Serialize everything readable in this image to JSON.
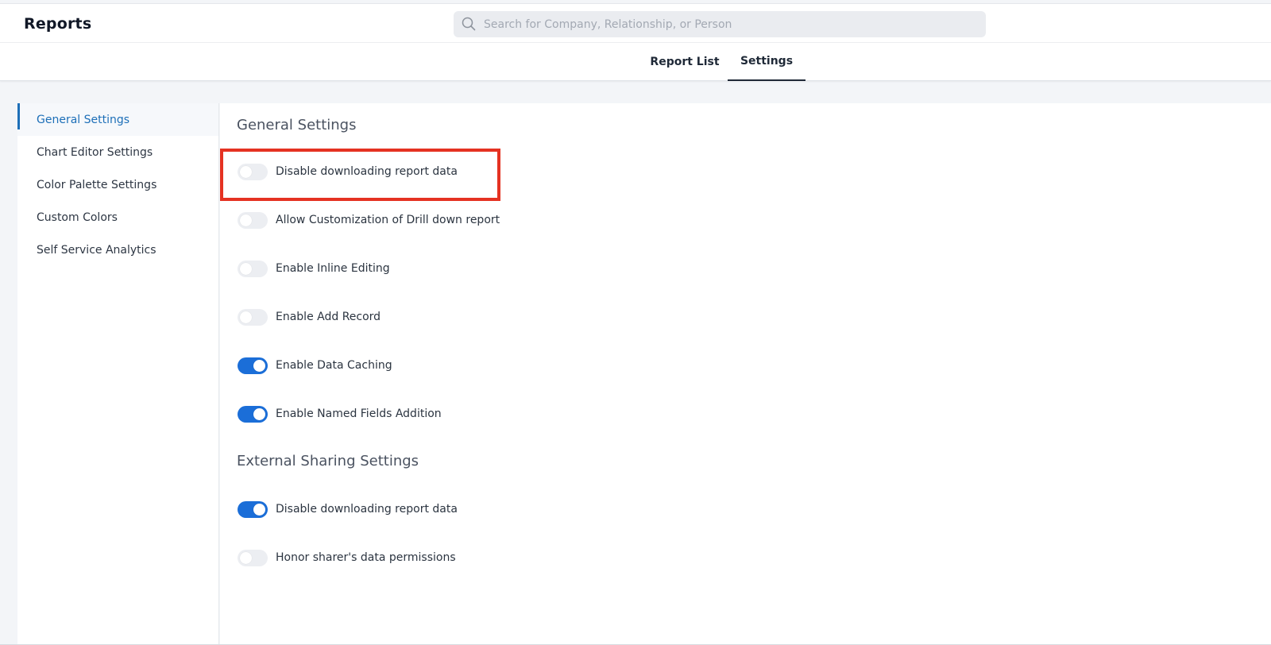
{
  "header": {
    "app_title": "Reports",
    "search_placeholder": "Search for Company, Relationship, or Person"
  },
  "tabs": [
    {
      "label": "Report List",
      "active": false
    },
    {
      "label": "Settings",
      "active": true
    }
  ],
  "sidebar": {
    "items": [
      {
        "label": "General Settings",
        "active": true
      },
      {
        "label": "Chart Editor Settings",
        "active": false
      },
      {
        "label": "Color Palette Settings",
        "active": false
      },
      {
        "label": "Custom Colors",
        "active": false
      },
      {
        "label": "Self Service Analytics",
        "active": false
      }
    ]
  },
  "general_settings": {
    "title": "General Settings",
    "toggles": [
      {
        "label": "Disable downloading report data",
        "on": false
      },
      {
        "label": "Allow Customization of Drill down report",
        "on": false
      },
      {
        "label": "Enable Inline Editing",
        "on": false
      },
      {
        "label": "Enable Add Record",
        "on": false
      },
      {
        "label": "Enable Data Caching",
        "on": true
      },
      {
        "label": "Enable Named Fields Addition",
        "on": true
      }
    ]
  },
  "external_sharing": {
    "title": "External Sharing Settings",
    "toggles": [
      {
        "label": "Disable downloading report data",
        "on": true
      },
      {
        "label": "Honor sharer's data permissions",
        "on": false
      }
    ]
  },
  "colors": {
    "accent": "#1b6ed8",
    "sidebar_active": "#1d6fb8",
    "highlight": "#e53222"
  }
}
